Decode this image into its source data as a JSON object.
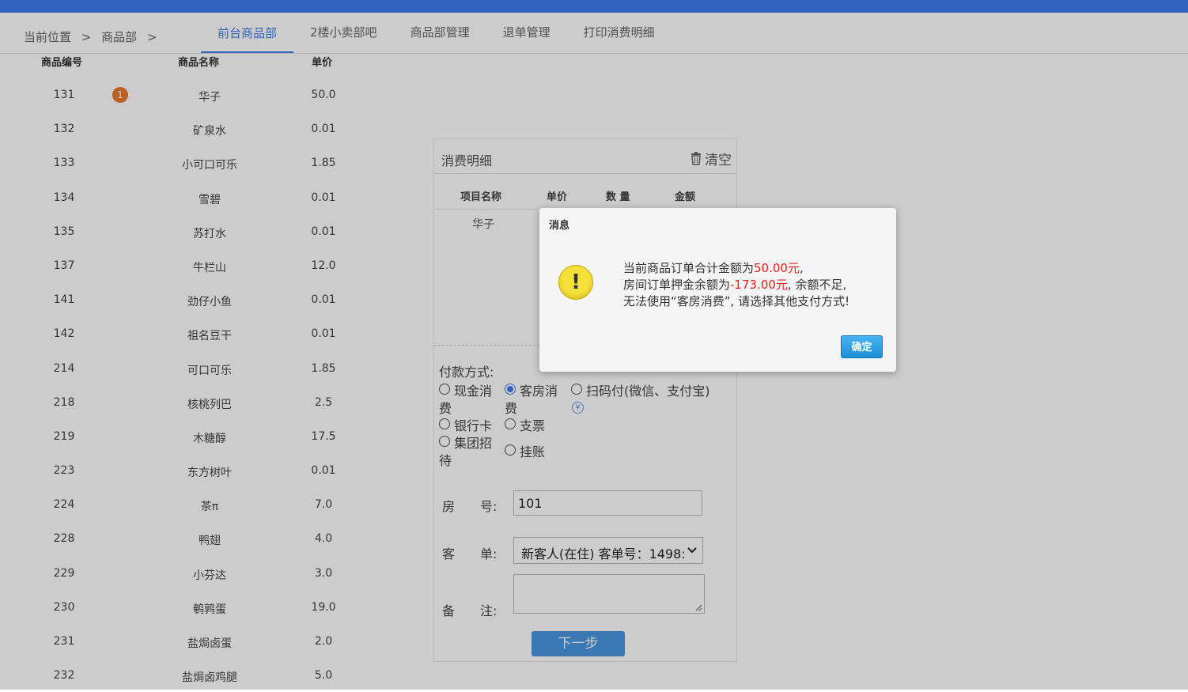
{
  "breadcrumb": {
    "label": "当前位置",
    "sep1": ">",
    "dept": "商品部",
    "sep2": ">"
  },
  "tabs": [
    "前台商品部",
    "2楼小卖部吧",
    "商品部管理",
    "退单管理",
    "打印消费明细"
  ],
  "goods": {
    "headers": {
      "id": "商品编号",
      "name": "商品名称",
      "price": "单价"
    },
    "badge": "1",
    "rows": [
      {
        "id": "131",
        "name": "华子",
        "price": "50.0"
      },
      {
        "id": "132",
        "name": "矿泉水",
        "price": "0.01"
      },
      {
        "id": "133",
        "name": "小可口可乐",
        "price": "1.85"
      },
      {
        "id": "134",
        "name": "雪碧",
        "price": "0.01"
      },
      {
        "id": "135",
        "name": "苏打水",
        "price": "0.01"
      },
      {
        "id": "137",
        "name": "牛栏山",
        "price": "12.0"
      },
      {
        "id": "141",
        "name": "劲仔小鱼",
        "price": "0.01"
      },
      {
        "id": "142",
        "name": "祖名豆干",
        "price": "0.01"
      },
      {
        "id": "214",
        "name": "可口可乐",
        "price": "1.85"
      },
      {
        "id": "218",
        "name": "核桃列巴",
        "price": "2.5"
      },
      {
        "id": "219",
        "name": "木糖醇",
        "price": "17.5"
      },
      {
        "id": "223",
        "name": "东方树叶",
        "price": "0.01"
      },
      {
        "id": "224",
        "name": "茶π",
        "price": "7.0"
      },
      {
        "id": "228",
        "name": "鸭翅",
        "price": "4.0"
      },
      {
        "id": "229",
        "name": "小芬达",
        "price": "3.0"
      },
      {
        "id": "230",
        "name": "鹌鹑蛋",
        "price": "19.0"
      },
      {
        "id": "231",
        "name": "盐焗卤蛋",
        "price": "2.0"
      },
      {
        "id": "232",
        "name": "盐焗卤鸡腿",
        "price": "5.0"
      }
    ]
  },
  "detail": {
    "title": "消费明细",
    "clear_label": "清空",
    "headers": {
      "name": "项目名称",
      "price": "单价",
      "qty": "数 量",
      "amount": "金额"
    },
    "row_name": "华子",
    "pay_label": "付款方式:",
    "pay_options": {
      "cash": "现金消费",
      "room": "客房消费",
      "scan": "扫码付(微信、支付宝)",
      "card": "银行卡",
      "cheque": "支票",
      "group": "集团招待",
      "credit": "挂账"
    },
    "selected_payment": "客房消费",
    "room_label": "房　　号:",
    "room_value": "101",
    "order_label": "客　　单:",
    "order_value": "新客人(在住) 客单号：1498:",
    "remark_label": "备　　注:",
    "next_label": "下一步"
  },
  "dialog": {
    "title": "消息",
    "line1_a": "当前商品订单合计金额为",
    "line1_b": "50.00元",
    "line1_c": ",",
    "line2_a": "房间订单押金余额为",
    "line2_b": "-173.00元",
    "line2_c": ", 余额不足,",
    "line3": "无法使用“客房消费”, 请选择其他支付方式!",
    "ok_label": "确定"
  },
  "colors": {
    "accent": "#3f7bea",
    "badge": "#e8782b",
    "danger": "#e4211c",
    "button": "#4a97e0"
  }
}
